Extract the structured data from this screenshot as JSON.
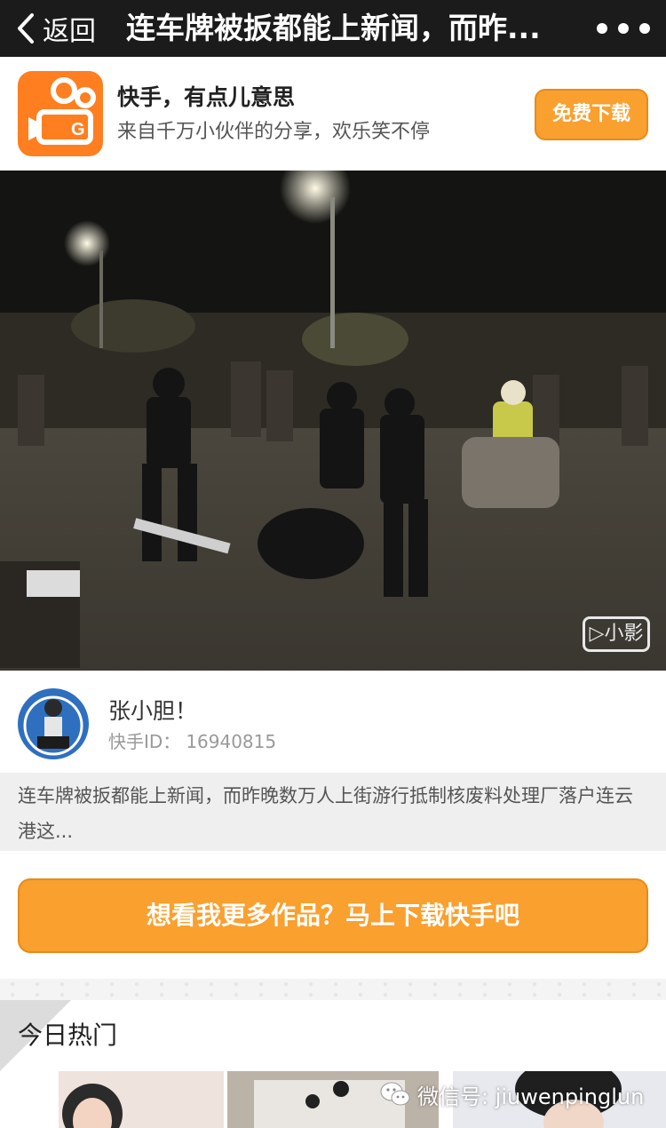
{
  "nav": {
    "back_label": "返回",
    "title": "连车牌被扳都能上新闻，而昨...",
    "back_icon": "chevron-left-icon",
    "more_icon": "more-dots-icon"
  },
  "banner": {
    "app_name": "快手，有点儿意思",
    "slogan": "来自千万小伙伴的分享，欢乐笑不停",
    "download_label": "免费下载",
    "accent_color": "#f9a02f"
  },
  "video": {
    "watermark": "▷小影"
  },
  "author": {
    "name": "张小胆！",
    "id_label": "快手ID：",
    "id_value": "16940815"
  },
  "description": "连车牌被扳都能上新闻，而昨晚数万人上街游行抵制核废料处理厂落户连云港这...",
  "cta_label": "想看我更多作品？马上下载快手吧",
  "hot": {
    "title": "今日热门"
  },
  "wechat_watermark": {
    "label": "微信号: jiuwenpinglun"
  }
}
